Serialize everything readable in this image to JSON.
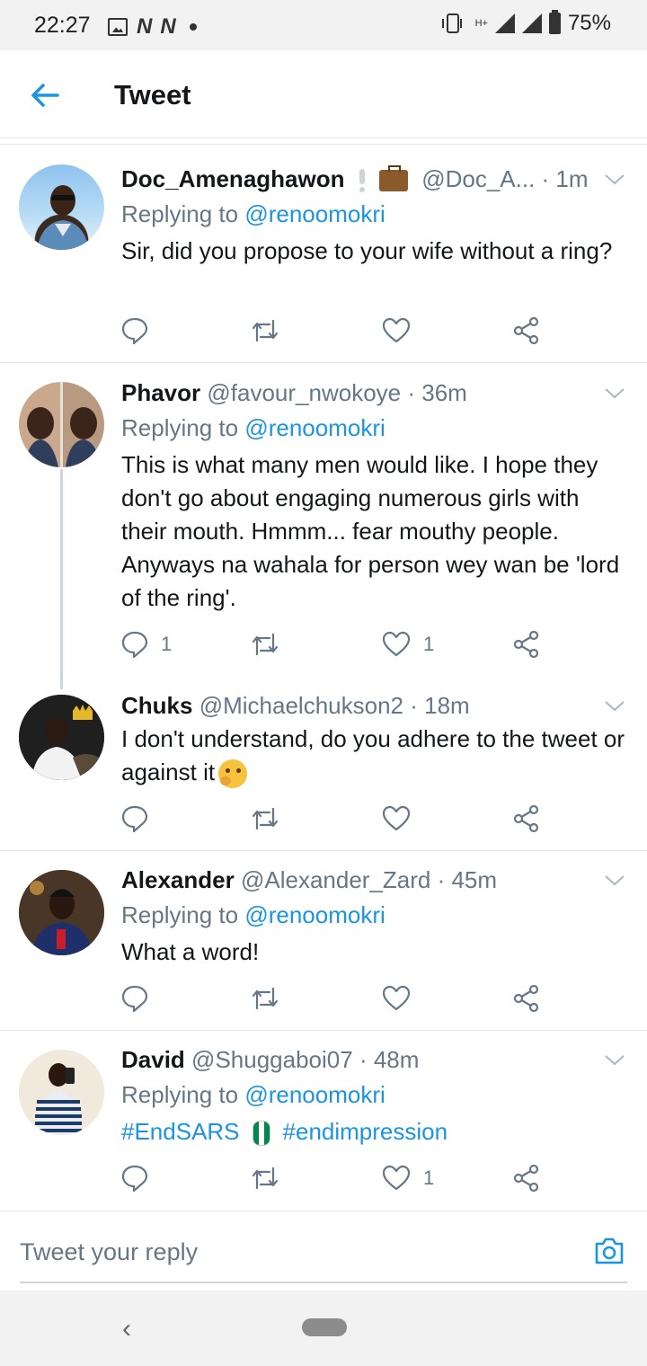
{
  "status_bar": {
    "time": "22:27",
    "network_letter_1": "N",
    "network_letter_2": "N",
    "network_type": "H+",
    "battery": "75%"
  },
  "header": {
    "title": "Tweet",
    "back_icon": "arrow-left-icon"
  },
  "tweets": [
    {
      "name": "Doc_Amenaghawon",
      "handle": "@Doc_A...",
      "time": "· 1m",
      "replying_prefix": "Replying to",
      "replying_to": "@renoomokri",
      "text": "Sir, did you propose to your wife without a ring?",
      "reply_count": "",
      "retweet_count": "",
      "like_count": ""
    },
    {
      "name": "Phavor",
      "handle": "@favour_nwokoye",
      "time": "· 36m",
      "replying_prefix": "Replying to",
      "replying_to": "@renoomokri",
      "text": "This is what many men would like. I hope they don't go about engaging numerous girls with their mouth. Hmmm... fear mouthy people. Anyways na wahala for person wey wan be 'lord of the ring'.",
      "reply_count": "1",
      "retweet_count": "",
      "like_count": "1"
    },
    {
      "name": "Chuks",
      "handle": "@Michaelchukson2",
      "time": "· 18m",
      "text": "I don't understand, do you adhere to the tweet or against it",
      "reply_count": "",
      "retweet_count": "",
      "like_count": ""
    },
    {
      "name": "Alexander",
      "handle": "@Alexander_Zard",
      "time": "· 45m",
      "replying_prefix": "Replying to",
      "replying_to": "@renoomokri",
      "text": "What a word!",
      "reply_count": "",
      "retweet_count": "",
      "like_count": ""
    },
    {
      "name": "David",
      "handle": "@Shuggaboi07",
      "time": "· 48m",
      "replying_prefix": "Replying to",
      "replying_to": "@renoomokri",
      "hashtag_1": "#EndSARS",
      "hashtag_2": "#endimpression",
      "reply_count": "",
      "retweet_count": "",
      "like_count": "1"
    }
  ],
  "reply_bar": {
    "placeholder": "Tweet your reply",
    "camera_icon": "camera-icon"
  },
  "nav_bar": {
    "back_glyph": "‹"
  },
  "colors": {
    "accent": "#1b95e0",
    "secondary_text": "#657786",
    "divider": "#e1e8ed"
  }
}
